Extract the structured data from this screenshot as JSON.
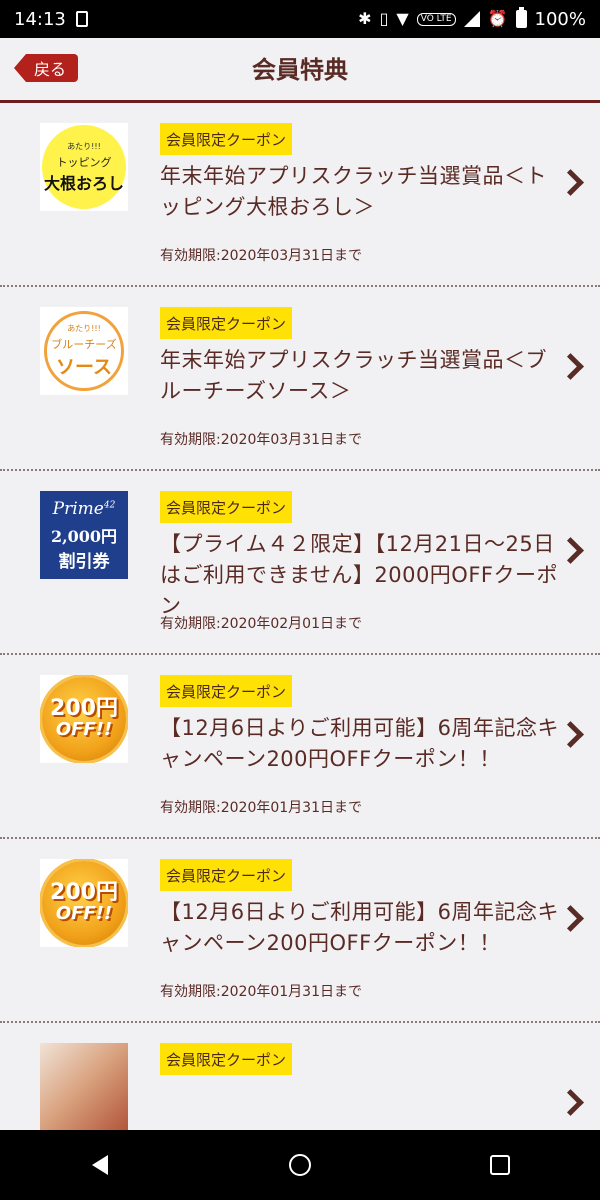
{
  "status_bar": {
    "time": "14:13",
    "volte": "VO LTE",
    "battery": "100%"
  },
  "header": {
    "back_label": "戻る",
    "title": "会員特典"
  },
  "coupons": [
    {
      "tag": "会員限定クーポン",
      "title": "年末年始アプリスクラッチ当選賞品＜トッピング大根おろし＞",
      "expiry": "有効期限:2020年03月31日まで",
      "thumb": {
        "small": "あたり!!!",
        "mid": "トッピング",
        "big": "大根おろし"
      }
    },
    {
      "tag": "会員限定クーポン",
      "title": "年末年始アプリスクラッチ当選賞品＜ブルーチーズソース＞",
      "expiry": "有効期限:2020年03月31日まで",
      "thumb": {
        "small": "あたり!!!",
        "mid": "ブルーチーズ",
        "big": "ソース"
      }
    },
    {
      "tag": "会員限定クーポン",
      "title": "【プライム４２限定】【12月21日～25日はご利用できません】2000円OFFクーポン",
      "expiry": "有効期限:2020年02月01日まで",
      "thumb": {
        "brand": "Prime",
        "brand_num": "42",
        "amount": "2,000円",
        "discount": "割引券"
      }
    },
    {
      "tag": "会員限定クーポン",
      "title": "【12月6日よりご利用可能】6周年記念キャンペーン200円OFFクーポン！！",
      "expiry": "有効期限:2020年01月31日まで",
      "thumb": {
        "num": "200円",
        "off": "OFF!!"
      }
    },
    {
      "tag": "会員限定クーポン",
      "title": "【12月6日よりご利用可能】6周年記念キャンペーン200円OFFクーポン！！",
      "expiry": "有効期限:2020年01月31日まで",
      "thumb": {
        "num": "200円",
        "off": "OFF!!"
      }
    },
    {
      "tag": "会員限定クーポン"
    }
  ],
  "colors": {
    "accent": "#b3211d",
    "text": "#5a2a24",
    "tag_bg": "#ffe105",
    "background": "#f1f1f4"
  }
}
